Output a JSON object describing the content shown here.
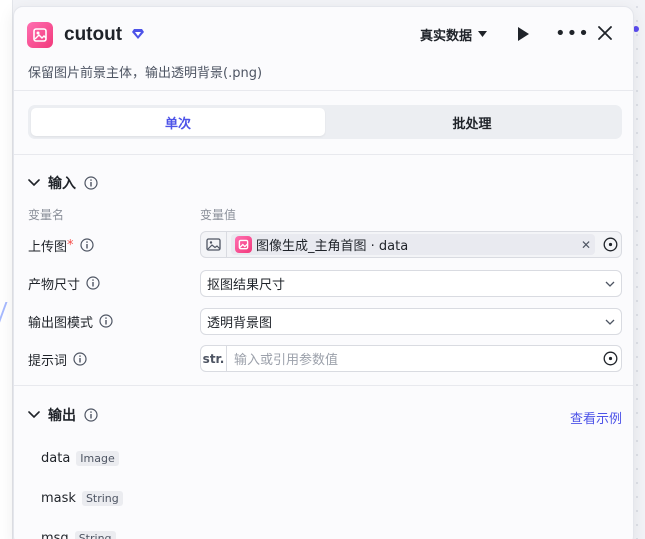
{
  "node": {
    "title": "cutout",
    "description": "保留图片前景主体，输出透明背景(.png)",
    "data_mode": "真实数据"
  },
  "tabs": [
    {
      "label": "单次",
      "active": true
    },
    {
      "label": "批处理",
      "active": false
    }
  ],
  "input": {
    "title": "输入",
    "col_name": "变量名",
    "col_value": "变量值",
    "rows": [
      {
        "label": "上传图",
        "required": true,
        "ref_node": "图像生成_主角首图",
        "ref_sep": " · ",
        "ref_field": "data"
      },
      {
        "label": "产物尺寸",
        "value": "抠图结果尺寸"
      },
      {
        "label": "输出图模式",
        "value": "透明背景图"
      },
      {
        "label": "提示词",
        "prefix": "str.",
        "placeholder": "输入或引用参数值"
      }
    ]
  },
  "output": {
    "title": "输出",
    "view_example": "查看示例",
    "items": [
      {
        "name": "data",
        "type": "Image"
      },
      {
        "name": "mask",
        "type": "String"
      },
      {
        "name": "msg",
        "type": "String"
      }
    ]
  },
  "colors": {
    "accent": "#4d53e8",
    "node_icon": "#f2397b",
    "required": "#f54a45"
  }
}
